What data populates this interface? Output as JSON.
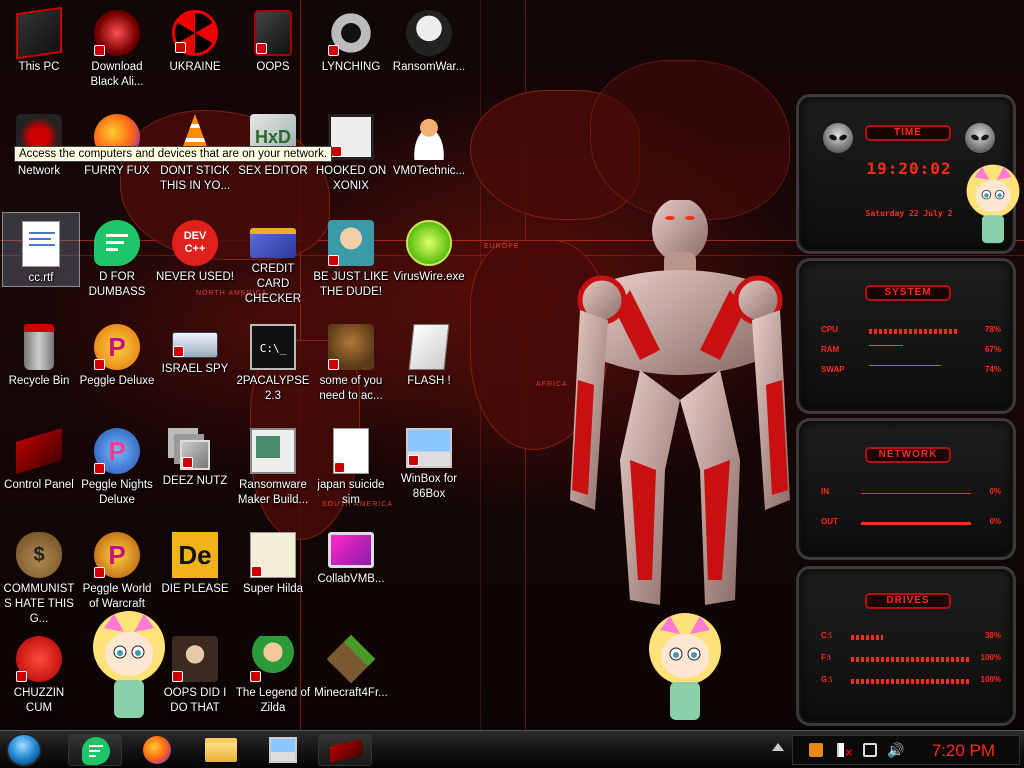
{
  "desktop": {
    "tooltip": "Access the computers and devices that are on your network.",
    "icons": [
      {
        "label": "This PC"
      },
      {
        "label": "Download Black Ali..."
      },
      {
        "label": "UKRAINE"
      },
      {
        "label": "OOPS"
      },
      {
        "label": "LYNCHING"
      },
      {
        "label": "RansomWar..."
      },
      {
        "label": "Network"
      },
      {
        "label": "FURRY FUX"
      },
      {
        "label": "DONT STICK THIS IN YO..."
      },
      {
        "label": "SEX EDITOR"
      },
      {
        "label": "HOOKED ON XONIX"
      },
      {
        "label": "VM0Technic..."
      },
      {
        "label": "cc.rtf"
      },
      {
        "label": "D FOR DUMBASS"
      },
      {
        "label": "NEVER USED!"
      },
      {
        "label": "CREDIT CARD CHECKER"
      },
      {
        "label": "BE JUST LIKE THE DUDE!"
      },
      {
        "label": "VirusWire.exe"
      },
      {
        "label": "Recycle Bin"
      },
      {
        "label": "Peggle Deluxe"
      },
      {
        "label": "ISRAEL SPY"
      },
      {
        "label": "2PACALYPSE 2.3"
      },
      {
        "label": "some of you need to ac..."
      },
      {
        "label": "FLASH !"
      },
      {
        "label": "Control Panel"
      },
      {
        "label": "Peggle Nights Deluxe"
      },
      {
        "label": "DEEZ NUTZ"
      },
      {
        "label": "Ransomware Maker Build..."
      },
      {
        "label": "japan suicide sim"
      },
      {
        "label": "WinBox for 86Box"
      },
      {
        "label": "COMMUNISTS HATE THIS G..."
      },
      {
        "label": "Peggle World of Warcraft"
      },
      {
        "label": "DIE PLEASE"
      },
      {
        "label": "Super Hilda"
      },
      {
        "label": "CollabVMB..."
      },
      {
        "label": "CHUZZIN CUM"
      },
      {
        "label": "OOPS DID I DO THAT"
      },
      {
        "label": "The Legend of Zilda"
      },
      {
        "label": "Minecraft4Fr..."
      }
    ],
    "dev_icon_text": "DEV C++",
    "de_icon_text": "De"
  },
  "wallpaper": {
    "map_labels": [
      "NORTH AMERICA",
      "EUROPE",
      "AFRICA",
      "SOUTH AMERICA"
    ]
  },
  "gadgets": {
    "time": {
      "title": "TIME",
      "digits": "19:20:02",
      "date": "Saturday 22 July 2"
    },
    "system": {
      "title": "SYSTEM",
      "rows": [
        {
          "name": "CPU",
          "value": "78%"
        },
        {
          "name": "RAM",
          "value": "67%"
        },
        {
          "name": "SWAP",
          "value": "74%"
        }
      ]
    },
    "network": {
      "title": "NETWORK",
      "rows": [
        {
          "name": "IN",
          "value": "0%"
        },
        {
          "name": "OUT",
          "value": "0%"
        }
      ]
    },
    "drives": {
      "title": "DRIVES",
      "rows": [
        {
          "name": "C:\\",
          "value": "38%"
        },
        {
          "name": "F:\\",
          "value": "100%"
        },
        {
          "name": "G:\\",
          "value": "100%"
        }
      ]
    }
  },
  "taskbar": {
    "clock": "7:20 PM"
  },
  "colors": {
    "accent_red": "#ff2a1a",
    "gadget_green": "#16c21a",
    "start_blue": "#2a8fd8"
  }
}
